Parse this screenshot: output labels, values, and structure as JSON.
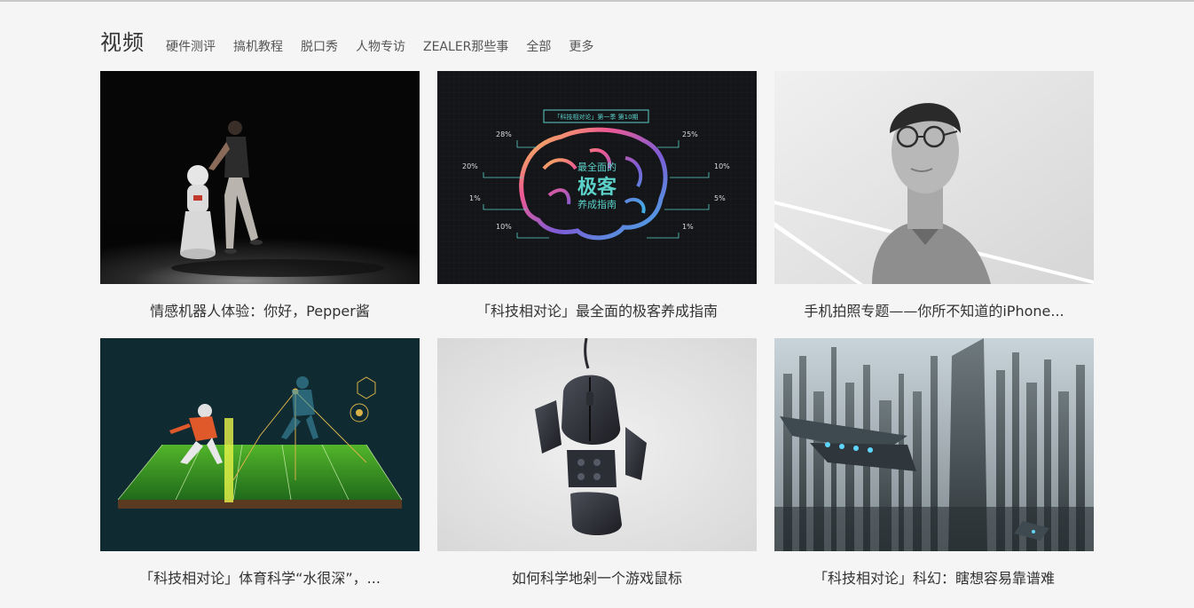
{
  "section": {
    "title": "视频",
    "categories": [
      "硬件测评",
      "搞机教程",
      "脱口秀",
      "人物专访",
      "ZEALER那些事",
      "全部",
      "更多"
    ]
  },
  "videos": [
    {
      "title": "情感机器人体验：你好，Pepper酱",
      "thumb_icon": "robot-thumbnail"
    },
    {
      "title": "「科技相对论」最全面的极客养成指南",
      "thumb_icon": "brain-infographic-thumbnail",
      "thumb_text": {
        "header": "「科技相对论」第一季 第10期",
        "center_line1": "最全面的",
        "center_line2": "极客",
        "center_line3": "养成指南",
        "left_stats": [
          "28%",
          "20%",
          "1%",
          "10%"
        ],
        "right_stats": [
          "25%",
          "10%",
          "5%",
          "1%"
        ]
      }
    },
    {
      "title": "手机拍照专题——你所不知道的iPhone...",
      "thumb_icon": "portrait-thumbnail"
    },
    {
      "title": "「科技相对论」体育科学“水很深”，...",
      "thumb_icon": "sports-field-thumbnail"
    },
    {
      "title": "如何科学地剁一个游戏鼠标",
      "thumb_icon": "gaming-mouse-thumbnail"
    },
    {
      "title": "「科技相对论」科幻：瞎想容易靠谱难",
      "thumb_icon": "scifi-city-thumbnail"
    }
  ],
  "colors": {
    "background": "#f5f5f5",
    "text": "#333333",
    "brain_accent": "#5bd1c9"
  }
}
